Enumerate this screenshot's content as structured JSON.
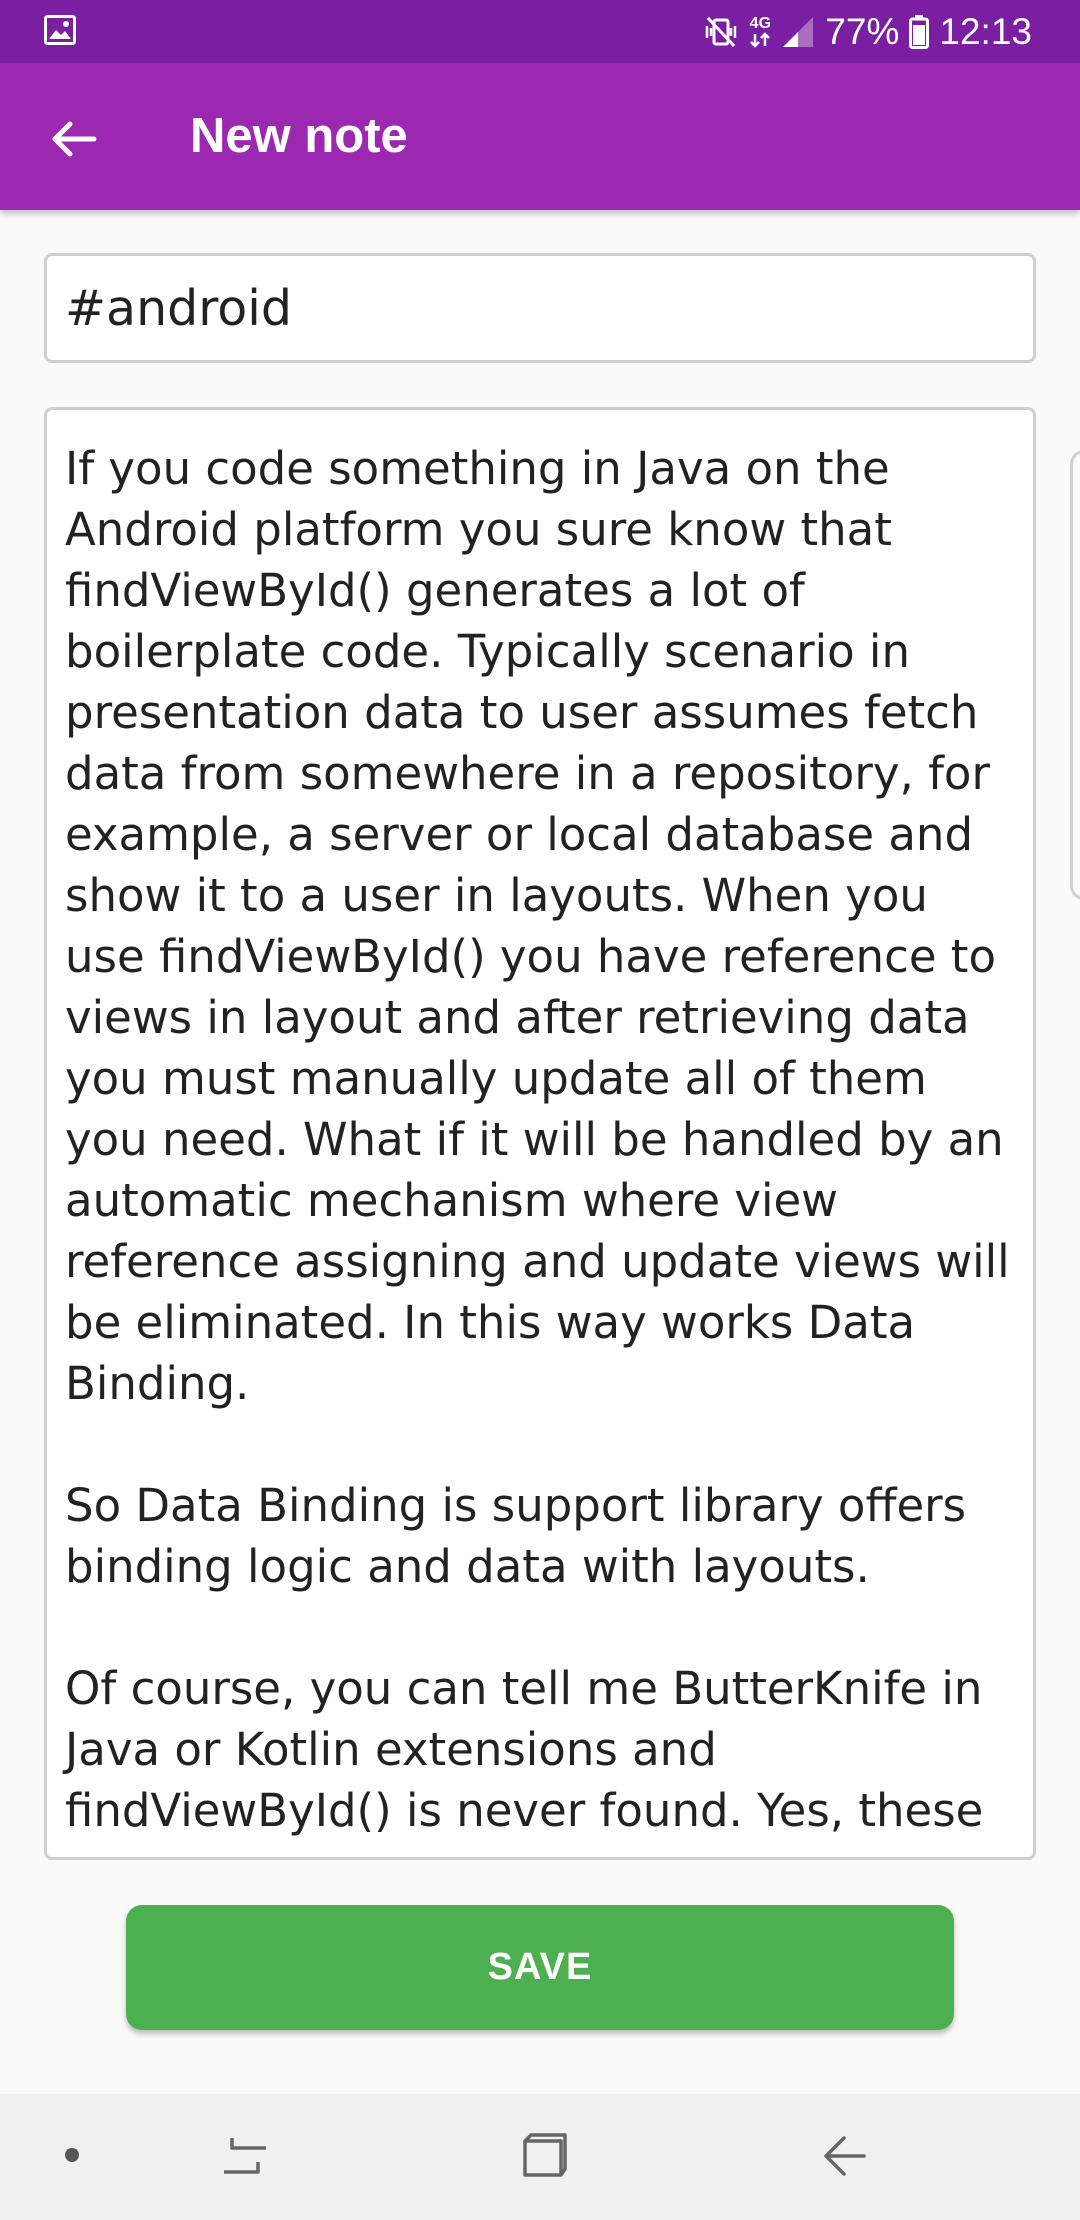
{
  "status_bar": {
    "left_icons": [
      "image-icon"
    ],
    "right_icons": [
      "mute-vibrate-icon",
      "network-4g-icon",
      "signal-icon",
      "battery-icon"
    ],
    "network_label": "4G",
    "battery": "77%",
    "time": "12:13"
  },
  "app_bar": {
    "title": "New note",
    "back_icon": "arrow-left-icon",
    "color": "#9c27b0",
    "status_color": "#7b1fa2"
  },
  "tag_field": {
    "value": "#android"
  },
  "note_body": {
    "paragraphs": [
      "If you code something in Java on the Android platform you sure know that findViewById() generates a lot of boilerplate code. Typically scenario in presentation data to user assumes fetch data from somewhere in a repository, for example, a server or local database and show it to a user in layouts. When you use findViewById() you have reference to views in layout and after retrieving data you must manually update all of them you need. What if it will be handled by an automatic mechanism where view reference assigning and update views will be eliminated. In this way works Data Binding.",
      "So Data Binding is support library offers binding logic and data with layouts.",
      "Of course, you can tell me ButterKnife in Java or Kotlin extensions and findViewById() is never found. Yes, these"
    ]
  },
  "save_button": {
    "label": "SAVE",
    "color": "#4caf50"
  },
  "nav_bar": {
    "icons": [
      "dot-icon",
      "recent-apps-icon",
      "home-icon",
      "back-icon"
    ]
  }
}
